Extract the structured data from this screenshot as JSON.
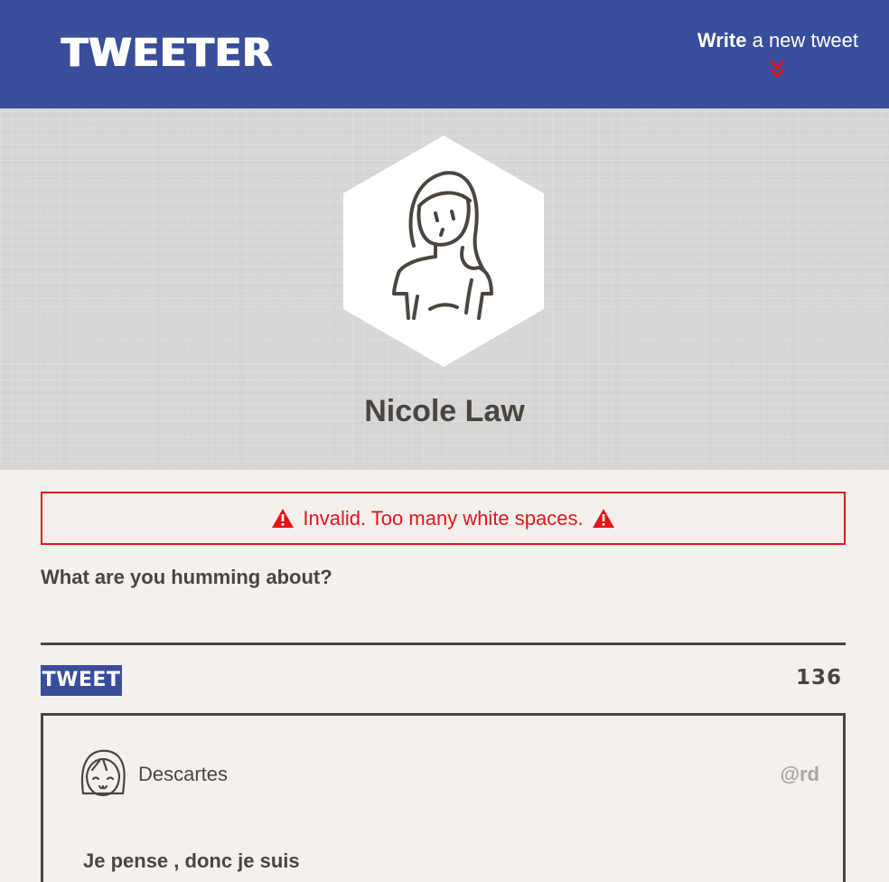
{
  "nav": {
    "brand": "TWEETER",
    "write_bold": "Write",
    "write_rest": " a new tweet",
    "chevron_icon": "double-chevron-down-icon",
    "background_color": "#3a4d9a",
    "chevron_color": "#e3151a"
  },
  "profile": {
    "name": "Nicole Law",
    "avatar_icon": "woman-avatar-icon"
  },
  "composer": {
    "error_message": "Invalid. Too many white spaces.",
    "error_color": "#e3151a",
    "label": "What are you humming about?",
    "input_value": "",
    "button_label": "TWEET",
    "char_counter": "136"
  },
  "tweets": [
    {
      "author": "Descartes",
      "handle": "@rd",
      "text": "Je pense , donc je suis",
      "avatar_icon": "girl-avatar-icon"
    }
  ]
}
